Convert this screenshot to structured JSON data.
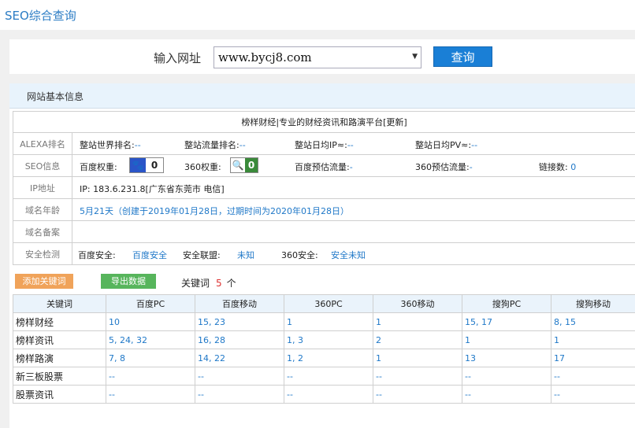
{
  "header": {
    "title": "SEO综合查询"
  },
  "search": {
    "label": "输入网址",
    "value": "www.bycj8.com",
    "button": "查询"
  },
  "panel": {
    "title": "网站基本信息"
  },
  "site": {
    "title": "榜样财经|专业的财经资讯和路演平台[更新]"
  },
  "alexa": {
    "label": "ALEXA排名",
    "items": [
      {
        "name": "整站世界排名:",
        "value": "--"
      },
      {
        "name": "整站流量排名:",
        "value": "--"
      },
      {
        "name": "整站日均IP≈:",
        "value": "--"
      },
      {
        "name": "整站日均PV≈:",
        "value": "--"
      }
    ]
  },
  "seo": {
    "label": "SEO信息",
    "baidu_weight_label": "百度权重:",
    "baidu_weight": "0",
    "w360_label": "360权重:",
    "w360": "0",
    "baidu_flow_label": "百度预估流量:",
    "baidu_flow": "-",
    "flow360_label": "360预估流量:",
    "flow360": "-",
    "links_label": "链接数:",
    "links": "0"
  },
  "ip": {
    "label": "IP地址",
    "value": "IP: 183.6.231.8[广东省东莞市 电信]"
  },
  "domain_age": {
    "label": "域名年龄",
    "value": "5月21天（创建于2019年01月28日，过期时间为2020年01月28日）"
  },
  "icp": {
    "label": "域名备案",
    "value": ""
  },
  "security": {
    "label": "安全检测",
    "baidu_label": "百度安全:",
    "baidu_value": "百度安全",
    "alliance_label": "安全联盟:",
    "alliance_value": "未知",
    "s360_label": "360安全:",
    "s360_value": "安全未知"
  },
  "actions": {
    "add": "添加关键词",
    "export": "导出数据",
    "kw_label": "关键词",
    "kw_count": "5",
    "kw_unit": "个"
  },
  "keywords": {
    "columns": [
      "关键词",
      "百度PC",
      "百度移动",
      "360PC",
      "360移动",
      "搜狗PC",
      "搜狗移动"
    ],
    "rows": [
      [
        "榜样财经",
        "10",
        "15, 23",
        "1",
        "1",
        "15, 17",
        "8, 15"
      ],
      [
        "榜样资讯",
        "5, 24, 32",
        "16, 28",
        "1, 3",
        "2",
        "1",
        "1"
      ],
      [
        "榜样路演",
        "7, 8",
        "14, 22",
        "1, 2",
        "1",
        "13",
        "17"
      ],
      [
        "新三板股票",
        "--",
        "--",
        "--",
        "--",
        "--",
        "--"
      ],
      [
        "股票资讯",
        "--",
        "--",
        "--",
        "--",
        "--",
        "--"
      ]
    ]
  },
  "colors": {
    "accent": "#1a7fd6",
    "link": "#1f78c8",
    "add_button": "#f0a35a",
    "export_button": "#57b55c"
  }
}
